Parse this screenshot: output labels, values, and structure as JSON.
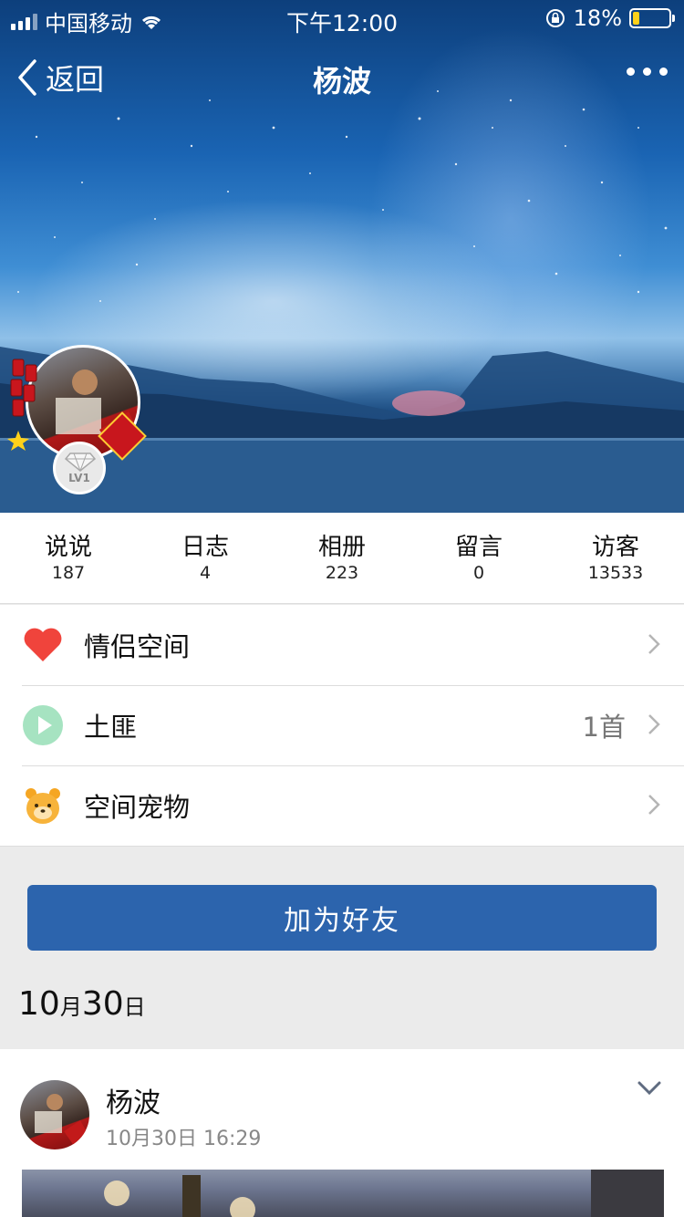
{
  "status_bar": {
    "carrier": "中国移动",
    "time": "下午12:00",
    "battery_percent": "18%",
    "battery_level": 0.18
  },
  "nav": {
    "back_label": "返回",
    "title": "杨波"
  },
  "profile": {
    "level_badge": "LV1"
  },
  "stats": [
    {
      "label": "说说",
      "value": "187"
    },
    {
      "label": "日志",
      "value": "4"
    },
    {
      "label": "相册",
      "value": "223"
    },
    {
      "label": "留言",
      "value": "0"
    },
    {
      "label": "访客",
      "value": "13533"
    }
  ],
  "menu": [
    {
      "label": "情侣空间",
      "icon": "heart-icon",
      "extra": ""
    },
    {
      "label": "土匪",
      "icon": "play-icon",
      "extra": "1首"
    },
    {
      "label": "空间宠物",
      "icon": "pet-icon",
      "extra": ""
    }
  ],
  "actions": {
    "add_friend": "加为好友"
  },
  "feed": {
    "date_day": "10",
    "date_month_unit": "月",
    "date_num": "30",
    "date_day_unit": "日",
    "post": {
      "author": "杨波",
      "time": "10月30日 16:29"
    }
  },
  "colors": {
    "primary_button": "#2c64ad",
    "heart": "#f0443c",
    "play": "#8ed9b0",
    "pet": "#f5a623"
  }
}
